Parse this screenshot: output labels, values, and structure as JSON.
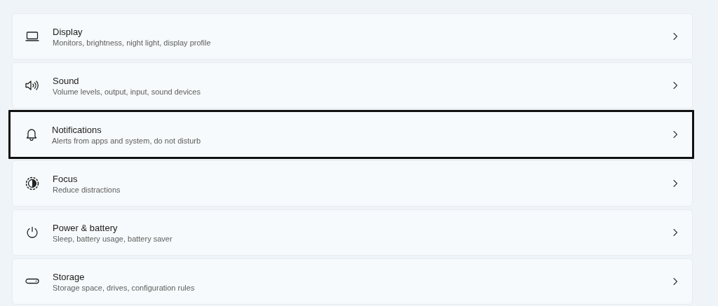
{
  "items": [
    {
      "kind": "display",
      "title": "Display",
      "subtitle": "Monitors, brightness, night light, display profile",
      "outlined": false
    },
    {
      "kind": "sound",
      "title": "Sound",
      "subtitle": "Volume levels, output, input, sound devices",
      "outlined": false
    },
    {
      "kind": "notifications",
      "title": "Notifications",
      "subtitle": "Alerts from apps and system, do not disturb",
      "outlined": true
    },
    {
      "kind": "focus",
      "title": "Focus",
      "subtitle": "Reduce distractions",
      "outlined": false
    },
    {
      "kind": "power",
      "title": "Power & battery",
      "subtitle": "Sleep, battery usage, battery saver",
      "outlined": false
    },
    {
      "kind": "storage",
      "title": "Storage",
      "subtitle": "Storage space, drives, configuration rules",
      "outlined": false
    }
  ]
}
